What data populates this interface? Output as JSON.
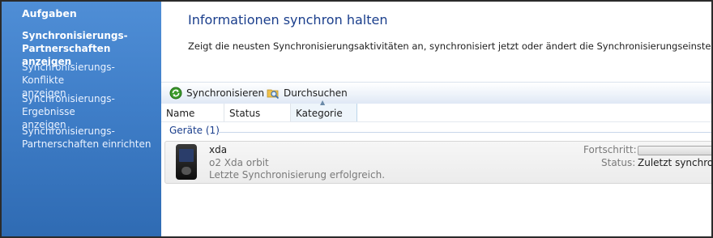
{
  "sidebar": {
    "heading": "Aufgaben",
    "items": [
      {
        "line1": "Synchronisierungs-",
        "line2": "Partnerschaften anzeigen",
        "active": true
      },
      {
        "line1": "Synchronisierungs- Konflikte",
        "line2": "anzeigen"
      },
      {
        "line1": "Synchronisierungs- Ergebnisse",
        "line2": "anzeigen"
      },
      {
        "line1": "Synchronisierungs-",
        "line2": "Partnerschaften einrichten"
      }
    ]
  },
  "main": {
    "title": "Informationen synchron halten",
    "description": "Zeigt die neusten Synchronisierungsaktivitäten an, synchronisiert jetzt oder ändert die Synchronisierungseinstellungen."
  },
  "toolbar": {
    "sync_label": "Synchronisieren",
    "browse_label": "Durchsuchen"
  },
  "columns": [
    "Name",
    "Status",
    "Kategorie"
  ],
  "group": {
    "label": "Geräte (1)"
  },
  "device": {
    "name": "xda",
    "model": "o2 Xda orbit",
    "last_sync": "Letzte Synchronisierung erfolgreich.",
    "progress_label": "Fortschritt:",
    "status_label": "Status:",
    "status_value": "Zuletzt synchroni",
    "progress_fraction": 0
  },
  "colors": {
    "sidebar": "#3f7ec8",
    "title": "#1a3e8c",
    "accent_green": "#3a9a2a"
  }
}
